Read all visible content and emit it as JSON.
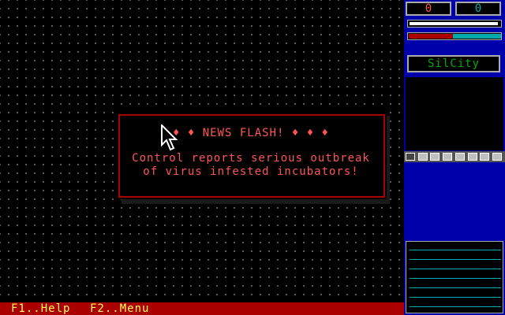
{
  "game": {
    "counters": {
      "left": "0",
      "right": "0"
    },
    "city_name": "SilCity",
    "status_bar": {
      "help": "F1..Help",
      "menu": "F2..Menu"
    },
    "news_flash": {
      "heading": "♦ ♦ NEWS FLASH! ♦ ♦ ♦",
      "line1": "Control reports serious outbreak",
      "line2": "of virus infested incubators!"
    },
    "meters": {
      "top_fill": 0.98,
      "bottom_red": 0.47
    }
  },
  "colors": {
    "background": "#000000",
    "panel": "#0000aa",
    "status_bar": "#aa0000",
    "status_text": "#ffff55",
    "news_text": "#ff5555",
    "city_text": "#00aa00",
    "counter_left": "#ff5555",
    "counter_right": "#00aaaa",
    "meter_cyan": "#00aaaa"
  },
  "icons": [
    "arrow-cursor-icon"
  ]
}
